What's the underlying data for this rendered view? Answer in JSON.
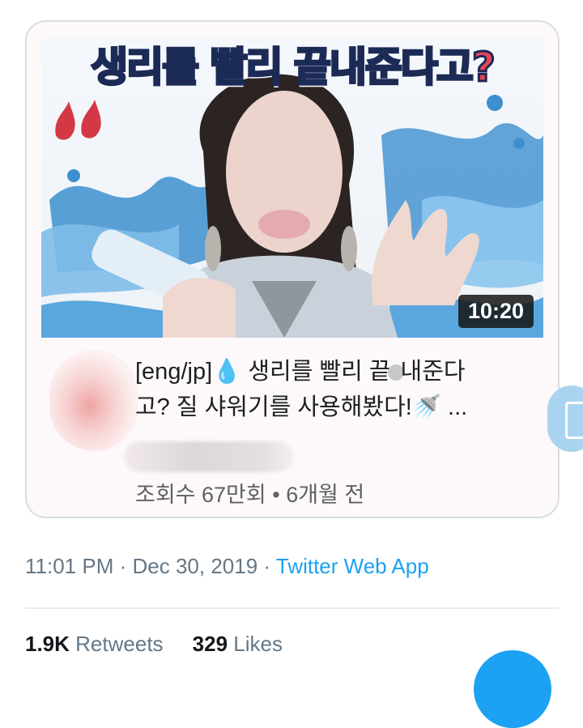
{
  "card": {
    "thumbnail": {
      "overlay_title": "생리를 빨리 끝내준다고?",
      "duration": "10:20"
    },
    "video_title": {
      "line1_prefix": "[eng/jp]",
      "line1_drop_emoji": "💧",
      "line1_text_a": "생리를 빨리 끝",
      "line1_text_b": "내준다",
      "line2_text": "고? 질 샤워기를 사용해봤다!",
      "line2_emoji": "🚿",
      "line2_ellipsis": "..."
    },
    "meta": "조회수 67만회 • 6개월 전"
  },
  "tweet": {
    "time": "11:01 PM",
    "date": "Dec 30, 2019",
    "separator": "·",
    "source": "Twitter Web App"
  },
  "stats": {
    "retweets_count": "1.9K",
    "retweets_label": "Retweets",
    "likes_count": "329",
    "likes_label": "Likes"
  },
  "colors": {
    "accent": "#1da1f2",
    "meta_gray": "#657786",
    "title_pink": "#e8435a",
    "title_stroke": "#1c2a56"
  },
  "icons": {
    "side": "sheet-icon",
    "fab": "compose-icon"
  }
}
